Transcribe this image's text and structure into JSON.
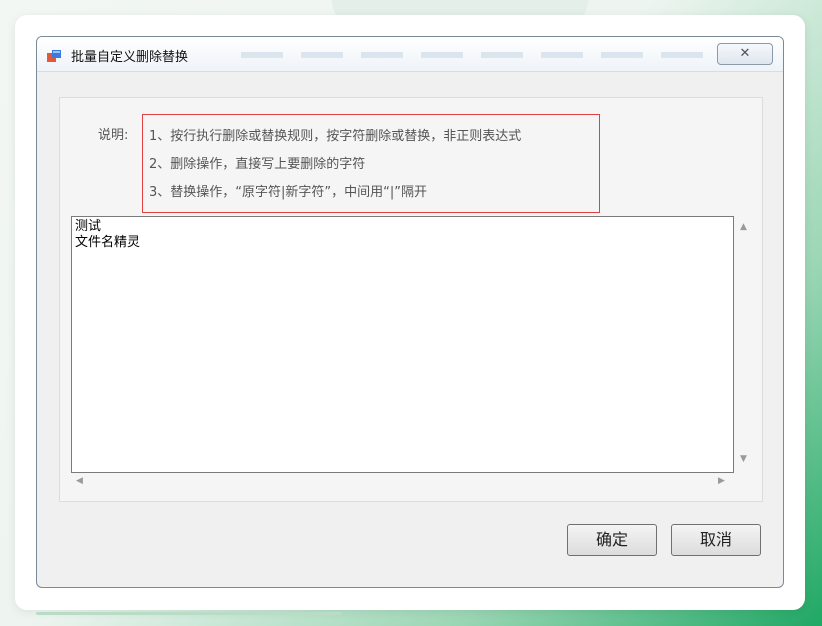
{
  "window": {
    "title": "批量自定义删除替换",
    "close_symbol": "✕",
    "icon": "app-window-icon"
  },
  "description": {
    "label": "说明:",
    "lines": [
      "1、按行执行删除或替换规则，按字符删除或替换，非正则表达式",
      "2、删除操作，直接写上要删除的字符",
      "3、替换操作，“原字符|新字符”，中间用“|”隔开"
    ]
  },
  "editor": {
    "lines": [
      "测试",
      "文件名精灵"
    ]
  },
  "buttons": {
    "ok": "确定",
    "cancel": "取消"
  },
  "colors": {
    "highlight_border": "#e34141",
    "accent_green": "#1fa864"
  }
}
